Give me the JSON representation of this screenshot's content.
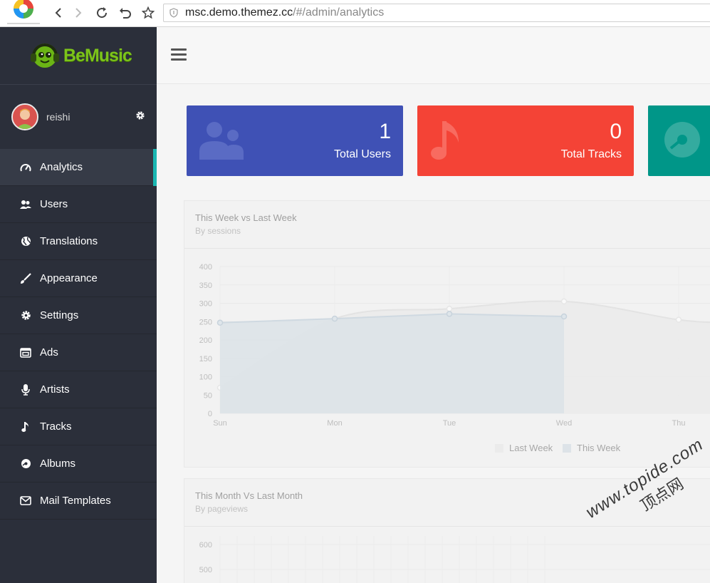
{
  "browser": {
    "url_host": "msc.demo.themez.cc",
    "url_path": "/#/admin/analytics"
  },
  "brand": {
    "name": "BeMusic"
  },
  "user": {
    "name": "reishi"
  },
  "sidebar": {
    "items": [
      {
        "label": "Analytics",
        "icon": "gauge-icon",
        "active": true
      },
      {
        "label": "Users",
        "icon": "users-icon"
      },
      {
        "label": "Translations",
        "icon": "globe-icon"
      },
      {
        "label": "Appearance",
        "icon": "brush-icon"
      },
      {
        "label": "Settings",
        "icon": "gear-icon"
      },
      {
        "label": "Ads",
        "icon": "ads-icon"
      },
      {
        "label": "Artists",
        "icon": "microphone-icon"
      },
      {
        "label": "Tracks",
        "icon": "music-note-icon"
      },
      {
        "label": "Albums",
        "icon": "disc-icon"
      },
      {
        "label": "Mail Templates",
        "icon": "envelope-icon"
      }
    ]
  },
  "cards": {
    "users": {
      "value": "1",
      "label": "Total Users",
      "color": "#3f51b5"
    },
    "tracks": {
      "value": "0",
      "label": "Total Tracks",
      "color": "#f44336"
    },
    "albums": {
      "color": "#009688"
    }
  },
  "week_chart": {
    "title": "This Week vs Last Week",
    "subtitle": "By sessions"
  },
  "month_chart": {
    "title": "This Month Vs Last Month",
    "subtitle": "By pageviews"
  },
  "chart_data": [
    {
      "type": "area",
      "title": "This Week vs Last Week",
      "subtitle": "By sessions",
      "categories": [
        "Sun",
        "Mon",
        "Tue",
        "Wed",
        "Thu"
      ],
      "ylim": [
        0,
        400
      ],
      "yticks": [
        0,
        50,
        100,
        150,
        200,
        250,
        300,
        350,
        400
      ],
      "series": [
        {
          "name": "Last Week",
          "values": [
            70,
            258,
            285,
            305,
            255
          ],
          "color": "#ebebeb"
        },
        {
          "name": "This Week",
          "values": [
            247,
            258,
            271,
            264
          ],
          "color": "#dde3e8"
        }
      ],
      "legend": "bottom",
      "grid": true
    },
    {
      "type": "line",
      "title": "This Month Vs Last Month",
      "subtitle": "By pageviews",
      "yticks": [
        600,
        500
      ],
      "grid": true
    }
  ],
  "watermark": {
    "line1": "www.topide.com",
    "line2": "顶点网"
  }
}
